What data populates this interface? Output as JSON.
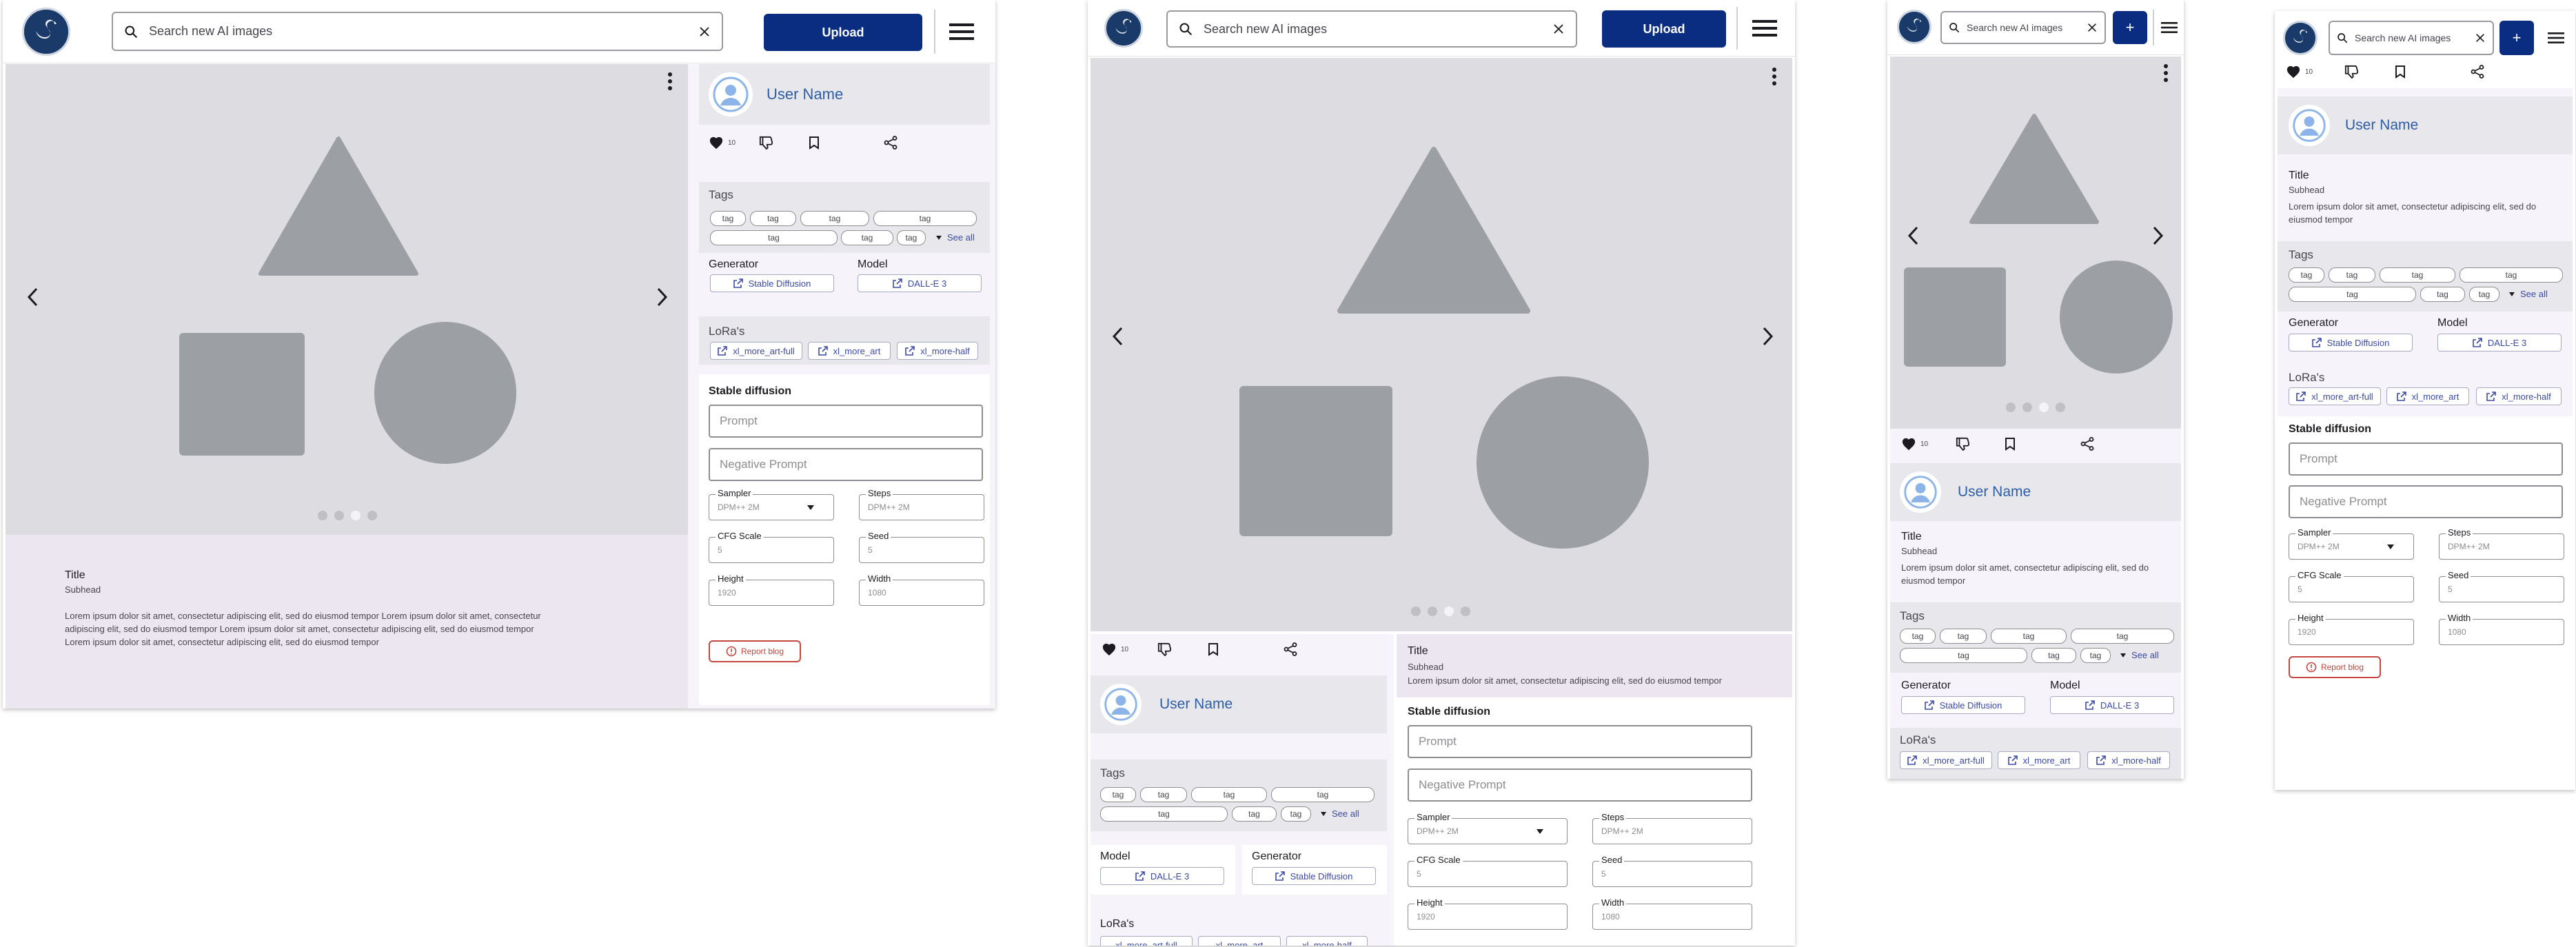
{
  "header": {
    "search_placeholder": "Search new AI images",
    "upload_label": "Upload",
    "upload_plus": "+"
  },
  "gallery": {
    "dots_total": 4,
    "dots_active": 3
  },
  "user": {
    "name": "User Name"
  },
  "actions": {
    "like_count": "10"
  },
  "post": {
    "title": "Title",
    "subhead": "Subhead",
    "body_long": "Lorem ipsum dolor sit amet, consectetur adipiscing elit, sed do eiusmod tempor Lorem ipsum dolor sit amet, consectetur adipiscing elit, sed do eiusmod tempor Lorem ipsum dolor sit amet, consectetur adipiscing elit, sed do eiusmod tempor Lorem ipsum dolor sit amet, consectetur adipiscing elit, sed do eiusmod tempor",
    "body_short": "Lorem ipsum dolor sit amet, consectetur adipiscing elit, sed do eiusmod tempor"
  },
  "tags": {
    "title": "Tags",
    "items": [
      "tag",
      "tag",
      "tag",
      "tag",
      "tag",
      "tag",
      "tag"
    ],
    "see_all": "See all"
  },
  "meta": {
    "generator_label": "Generator",
    "generator_value": "Stable Diffusion",
    "model_label": "Model",
    "model_value": "DALL-E 3"
  },
  "loras": {
    "title": "LoRa's",
    "items": [
      "xl_more_art-full",
      "xl_more_art",
      "xl_more-half"
    ]
  },
  "sd": {
    "title": "Stable diffusion",
    "prompt_placeholder": "Prompt",
    "negative_placeholder": "Negative Prompt",
    "sampler_label": "Sampler",
    "sampler_value": "DPM++ 2M",
    "steps_label": "Steps",
    "steps_value": "DPM++ 2M",
    "cfg_label": "CFG Scale",
    "cfg_value": "5",
    "seed_label": "Seed",
    "seed_value": "5",
    "height_label": "Height",
    "height_value": "1920",
    "width_label": "Width",
    "width_value": "1080"
  },
  "report": {
    "label": "Report blog"
  },
  "colors": {
    "primary": "#0a2d82",
    "link": "#2c5ea8",
    "chip_text": "#3b4aa8",
    "danger": "#c2473f",
    "gallery_bg": "#dcdce1",
    "shape": "#9c9fa4"
  }
}
